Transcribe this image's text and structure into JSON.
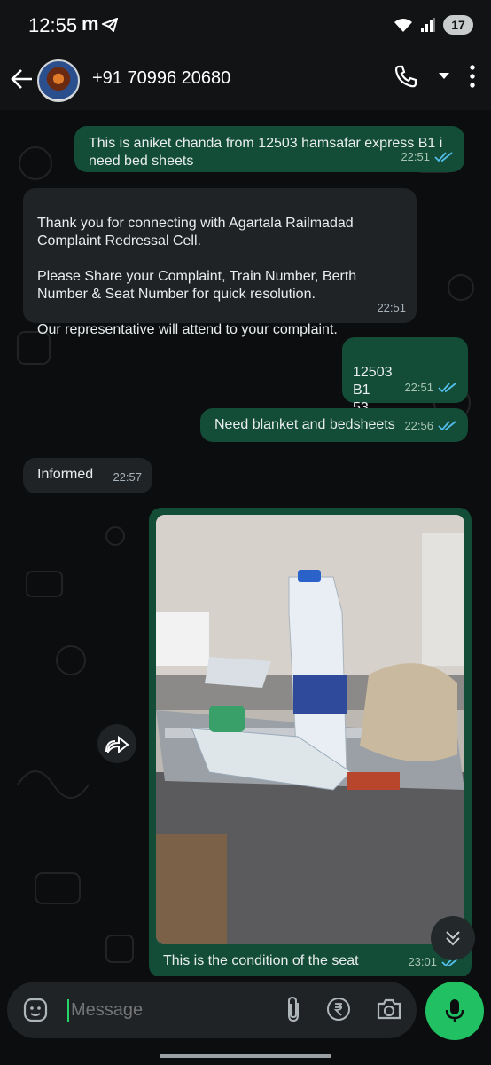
{
  "status_bar": {
    "time": "12:55",
    "carrier_glyph": "m",
    "battery": "17"
  },
  "header": {
    "contact": "+91 70996 20680",
    "icons": [
      "back-arrow-icon",
      "avatar",
      "phone-icon",
      "dropdown-icon",
      "more-icon"
    ]
  },
  "messages": [
    {
      "dir": "out",
      "text": "This is aniket chanda from 12503 hamsafar express B1 i need bed sheets",
      "time": "22:51",
      "ticks": "read"
    },
    {
      "dir": "in",
      "text": "Thank you for connecting with Agartala Railmadad Complaint Redressal Cell.\n\nPlease Share your Complaint, Train Number, Berth Number & Seat Number for quick resolution.\n\nOur representative will attend to your complaint.",
      "time": "22:51"
    },
    {
      "dir": "out",
      "text": "12503\nB1\n53",
      "time": "22:51",
      "ticks": "read"
    },
    {
      "dir": "out",
      "text": "Need blanket and bedsheets",
      "time": "22:56",
      "ticks": "read"
    },
    {
      "dir": "in",
      "text": "Informed",
      "time": "22:57"
    },
    {
      "dir": "out",
      "type": "image",
      "caption": "This is the condition of the seat",
      "time": "23:01",
      "ticks": "read"
    }
  ],
  "input": {
    "placeholder": "Message"
  },
  "colors": {
    "out_bubble": "#134d37",
    "in_bubble": "#1f2326",
    "accent": "#21c063",
    "read_tick": "#53bdeb"
  }
}
